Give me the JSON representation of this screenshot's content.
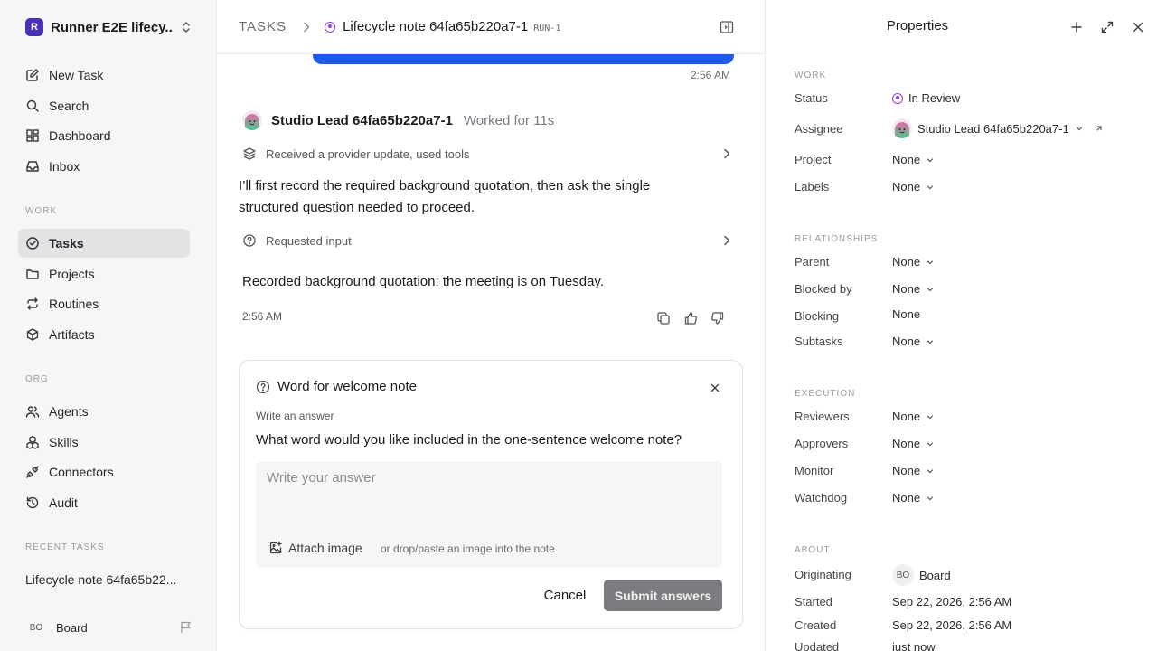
{
  "sidebar": {
    "workspace": {
      "initial": "R",
      "name": "Runner E2E lifecy..."
    },
    "top_items": [
      {
        "label": "New Task"
      },
      {
        "label": "Search"
      },
      {
        "label": "Dashboard"
      },
      {
        "label": "Inbox"
      }
    ],
    "sections": {
      "work": "WORK",
      "org": "ORG",
      "recent": "RECENT TASKS"
    },
    "work_items": [
      {
        "label": "Tasks"
      },
      {
        "label": "Projects"
      },
      {
        "label": "Routines"
      },
      {
        "label": "Artifacts"
      }
    ],
    "org_items": [
      {
        "label": "Agents"
      },
      {
        "label": "Skills"
      },
      {
        "label": "Connectors"
      },
      {
        "label": "Audit"
      }
    ],
    "recent_task": "Lifecycle note 64fa65b22...",
    "user": {
      "initials": "BO",
      "name": "Board"
    }
  },
  "header": {
    "root": "TASKS",
    "title": "Lifecycle note 64fa65b220a7-1",
    "run": "RUN-1"
  },
  "conversation": {
    "time_top": "2:56 AM",
    "agent_name": "Studio Lead 64fa65b220a7-1",
    "worked": "Worked for 11s",
    "step1": "Received a provider update, used tools",
    "message": "I’ll first record the required background quotation, then ask the single structured question needed to proceed.",
    "step2": "Requested input",
    "result": "Recorded background quotation: the meeting is on Tuesday.",
    "time_bottom": "2:56 AM"
  },
  "question_card": {
    "title": "Word for welcome note",
    "label": "Write an answer",
    "question": "What word would you like included in the one-sentence welcome note?",
    "placeholder": "Write your answer",
    "attach": "Attach image",
    "hint": "or drop/paste an image into the note",
    "cancel": "Cancel",
    "submit": "Submit answers"
  },
  "properties": {
    "title": "Properties",
    "sections": {
      "work": "WORK",
      "relationships": "RELATIONSHIPS",
      "execution": "EXECUTION",
      "about": "ABOUT"
    },
    "status": {
      "key": "Status",
      "value": "In Review"
    },
    "assignee": {
      "key": "Assignee",
      "value": "Studio Lead 64fa65b220a7-1"
    },
    "project": {
      "key": "Project",
      "value": "None"
    },
    "labels": {
      "key": "Labels",
      "value": "None"
    },
    "parent": {
      "key": "Parent",
      "value": "None"
    },
    "blocked_by": {
      "key": "Blocked by",
      "value": "None"
    },
    "blocking": {
      "key": "Blocking",
      "value": "None"
    },
    "subtasks": {
      "key": "Subtasks",
      "value": "None"
    },
    "reviewers": {
      "key": "Reviewers",
      "value": "None"
    },
    "approvers": {
      "key": "Approvers",
      "value": "None"
    },
    "monitor": {
      "key": "Monitor",
      "value": "None"
    },
    "watchdog": {
      "key": "Watchdog",
      "value": "None"
    },
    "originating": {
      "key": "Originating",
      "initials": "BO",
      "value": "Board"
    },
    "started": {
      "key": "Started",
      "value": "Sep 22, 2026, 2:56 AM"
    },
    "created": {
      "key": "Created",
      "value": "Sep 22, 2026, 2:56 AM"
    },
    "updated": {
      "key": "Updated",
      "value": "just now"
    }
  },
  "colors": {
    "accent_blue": "#1e5ae6",
    "status_purple": "#9b3fd6",
    "workspace_purple": "#4b2fb8"
  }
}
